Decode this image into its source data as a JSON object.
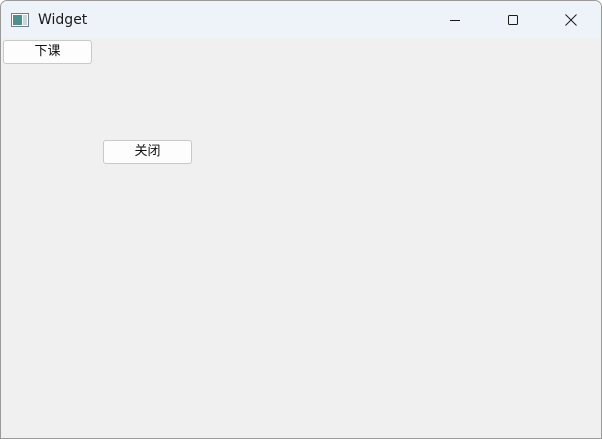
{
  "window": {
    "title": "Widget",
    "icon": "qt-widget-window-icon",
    "controls": {
      "minimize": "minimize-icon",
      "maximize": "maximize-icon",
      "close": "close-icon"
    }
  },
  "buttons": {
    "dismiss_class_label": "下课",
    "close_label": "关闭"
  },
  "colors": {
    "titlebar_bg": "#eef3fa",
    "client_bg": "#f0f0f0",
    "button_bg": "#fdfdfd",
    "button_border": "#c9c9c9"
  }
}
